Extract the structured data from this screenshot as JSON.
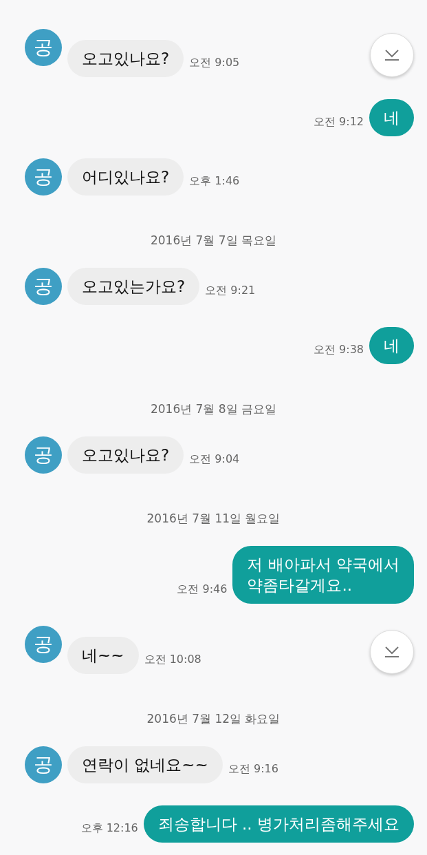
{
  "messages": [
    {
      "kind": "incoming",
      "avatar": "공",
      "text": "오고있나요?",
      "time": "오전 9:05",
      "scroll_button": true
    },
    {
      "kind": "outgoing",
      "text": "네",
      "time": "오전 9:12"
    },
    {
      "kind": "incoming",
      "avatar": "공",
      "text": "어디있나요?",
      "time": "오후 1:46"
    },
    {
      "kind": "date",
      "text": "2016년 7월 7일 목요일"
    },
    {
      "kind": "incoming",
      "avatar": "공",
      "text": "오고있는가요?",
      "time": "오전 9:21"
    },
    {
      "kind": "outgoing",
      "text": "네",
      "time": "오전 9:38"
    },
    {
      "kind": "date",
      "text": "2016년 7월 8일 금요일"
    },
    {
      "kind": "incoming",
      "avatar": "공",
      "text": "오고있나요?",
      "time": "오전 9:04"
    },
    {
      "kind": "date",
      "text": "2016년 7월 11일 월요일"
    },
    {
      "kind": "outgoing",
      "text": "저 배아파서 약국에서\n약좀타갈게요..",
      "time": "오전 9:46"
    },
    {
      "kind": "incoming",
      "avatar": "공",
      "text": "네~~",
      "time": "오전 10:08",
      "scroll_button": true
    },
    {
      "kind": "date",
      "text": "2016년 7월 12일 화요일"
    },
    {
      "kind": "incoming",
      "avatar": "공",
      "text": "연락이 없네요~~",
      "time": "오전 9:16"
    },
    {
      "kind": "outgoing",
      "text": "죄송합니다 .. 병가처리좀해주세요",
      "time": "오후 12:16"
    }
  ]
}
